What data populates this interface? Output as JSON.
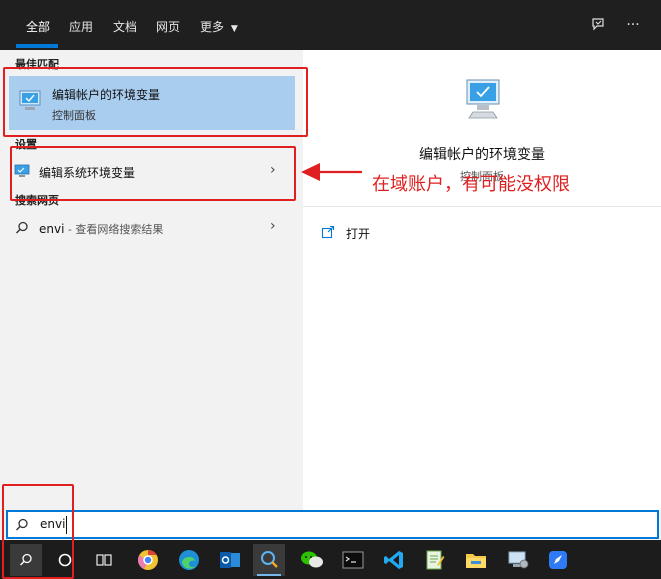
{
  "tabs": [
    {
      "label": "全部",
      "active": true
    },
    {
      "label": "应用"
    },
    {
      "label": "文档"
    },
    {
      "label": "网页"
    },
    {
      "label": "更多"
    }
  ],
  "sections": {
    "best_match": "最佳匹配",
    "settings": "设置",
    "web_search": "搜索网页"
  },
  "best_match_item": {
    "title": "编辑帐户的环境变量",
    "subtitle": "控制面板"
  },
  "settings_item": {
    "title": "编辑系统环境变量"
  },
  "web_item": {
    "query": "envi",
    "suffix": " - 查看网络搜索结果"
  },
  "detail": {
    "title": "编辑帐户的环境变量",
    "subtitle": "控制面板",
    "action_open": "打开"
  },
  "search": {
    "value": "envi"
  },
  "annotation": {
    "text": "在域账户，有可能没权限"
  },
  "colors": {
    "accent": "#0078d7",
    "selected": "#a9cdee",
    "annotation": "#e02020"
  },
  "taskbar_icons": [
    "search-icon",
    "cortana-icon",
    "task-view-icon",
    "chrome-icon",
    "edge-icon",
    "outlook-icon",
    "search-app-icon",
    "wechat-icon",
    "terminal-icon",
    "vscode-icon",
    "notepad-icon",
    "file-explorer-icon",
    "control-panel-icon",
    "feishu-icon"
  ]
}
